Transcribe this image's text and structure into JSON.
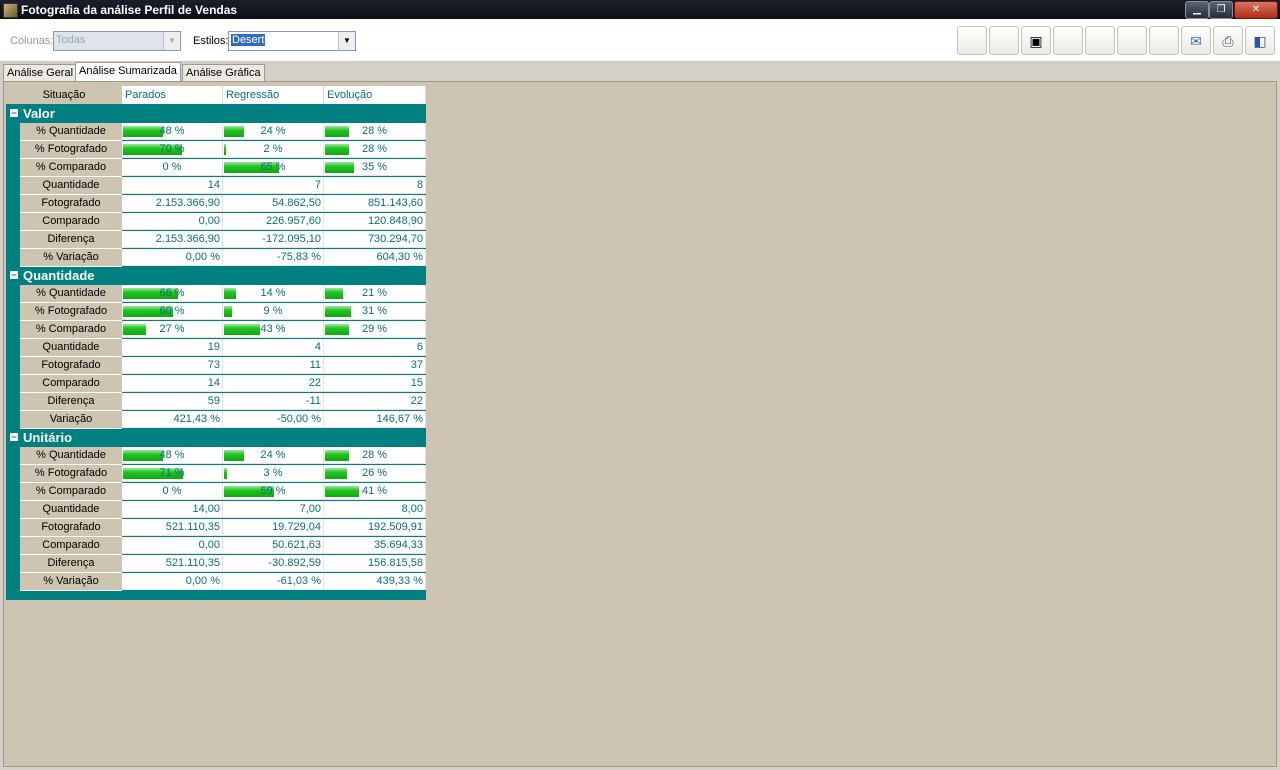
{
  "window": {
    "title": "Fotografia da análise Perfil de Vendas"
  },
  "toolbar": {
    "colunas_label": "Colunas:",
    "colunas_value": "Todas",
    "estilos_label": "Estilos:",
    "estilos_value": "Desert"
  },
  "tabs": [
    {
      "label": "Análise Geral"
    },
    {
      "label": "Análise Sumarizada"
    },
    {
      "label": "Análise Gráfica"
    }
  ],
  "grid": {
    "situacao": "Situação",
    "columns": [
      "Parados",
      "Regressão",
      "Evolução"
    ],
    "sections": [
      {
        "title": "Valor",
        "rows": [
          {
            "label": "% Quantidade",
            "cells": [
              "48 %",
              "24 %",
              "28 %"
            ],
            "bars": [
              0.48,
              0.24,
              0.28
            ]
          },
          {
            "label": "% Fotografado",
            "cells": [
              "70 %",
              "2 %",
              "28 %"
            ],
            "bars": [
              0.7,
              0.02,
              0.28
            ]
          },
          {
            "label": "% Comparado",
            "cells": [
              "0 %",
              "65 %",
              "35 %"
            ],
            "bars": [
              0.0,
              0.65,
              0.35
            ]
          },
          {
            "label": "Quantidade",
            "cells": [
              "14",
              "7",
              "8"
            ]
          },
          {
            "label": "Fotografado",
            "cells": [
              "2.153.366,90",
              "54.862,50",
              "851.143,60"
            ]
          },
          {
            "label": "Comparado",
            "cells": [
              "0,00",
              "226.957,60",
              "120.848,90"
            ]
          },
          {
            "label": "Diferença",
            "cells": [
              "2.153.366,90",
              "-172.095,10",
              "730.294,70"
            ]
          },
          {
            "label": "% Variação",
            "cells": [
              "0,00 %",
              "-75,83 %",
              "604,30 %"
            ]
          }
        ]
      },
      {
        "title": "Quantidade",
        "rows": [
          {
            "label": "% Quantidade",
            "cells": [
              "66 %",
              "14 %",
              "21 %"
            ],
            "bars": [
              0.66,
              0.14,
              0.21
            ]
          },
          {
            "label": "% Fotografado",
            "cells": [
              "60 %",
              "9 %",
              "31 %"
            ],
            "bars": [
              0.6,
              0.09,
              0.31
            ]
          },
          {
            "label": "% Comparado",
            "cells": [
              "27 %",
              "43 %",
              "29 %"
            ],
            "bars": [
              0.27,
              0.43,
              0.29
            ]
          },
          {
            "label": "Quantidade",
            "cells": [
              "19",
              "4",
              "6"
            ]
          },
          {
            "label": "Fotografado",
            "cells": [
              "73",
              "11",
              "37"
            ]
          },
          {
            "label": "Comparado",
            "cells": [
              "14",
              "22",
              "15"
            ]
          },
          {
            "label": "Diferença",
            "cells": [
              "59",
              "-11",
              "22"
            ]
          },
          {
            "label": "Variação",
            "cells": [
              "421,43 %",
              "-50,00 %",
              "146,67 %"
            ]
          }
        ]
      },
      {
        "title": "Unitário",
        "rows": [
          {
            "label": "% Quantidade",
            "cells": [
              "48 %",
              "24 %",
              "28 %"
            ],
            "bars": [
              0.48,
              0.24,
              0.28
            ]
          },
          {
            "label": "% Fotografado",
            "cells": [
              "71 %",
              "3 %",
              "26 %"
            ],
            "bars": [
              0.71,
              0.03,
              0.26
            ]
          },
          {
            "label": "% Comparado",
            "cells": [
              "0 %",
              "59 %",
              "41 %"
            ],
            "bars": [
              0.0,
              0.59,
              0.41
            ]
          },
          {
            "label": "Quantidade",
            "cells": [
              "14,00",
              "7,00",
              "8,00"
            ]
          },
          {
            "label": "Fotografado",
            "cells": [
              "521.110,35",
              "19.729,04",
              "192.509,91"
            ]
          },
          {
            "label": "Comparado",
            "cells": [
              "0,00",
              "50.621,63",
              "35.694,33"
            ]
          },
          {
            "label": "Diferença",
            "cells": [
              "521.110,35",
              "-30.892,59",
              "156.815,58"
            ]
          },
          {
            "label": "% Variação",
            "cells": [
              "0,00 %",
              "-61,03 %",
              "439,33 %"
            ]
          }
        ]
      }
    ]
  },
  "icons": {
    "toolbar_buttons": [
      "blank",
      "blank",
      "camera-icon",
      "blank",
      "blank",
      "blank",
      "blank",
      "email-icon",
      "print-icon",
      "exit-icon"
    ]
  }
}
